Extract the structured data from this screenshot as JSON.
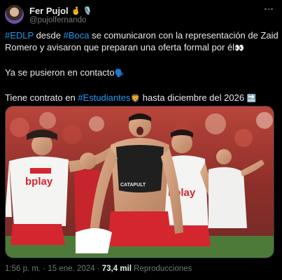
{
  "author": {
    "display_name": "Fer Pujol",
    "name_emojis": "🤞 🎙️",
    "handle": "@pujolfernando"
  },
  "tweet": {
    "line1_tag1": "#EDLP",
    "line1_text1": " desde ",
    "line1_tag2": "#Boca",
    "line1_text2": " se comunicaron con la representación de Zaid",
    "line2": "Romero y avisaron que preparan una oferta formal por él",
    "line2_emoji": "👀",
    "line3": "Ya se pusieron en contacto",
    "line3_emoji": "🗣️",
    "line4_text1": "Tiene contrato en ",
    "line4_tag": "#Estudiantes",
    "line4_emoji": "🦁",
    "line4_text2": " hasta diciembre del 2026 ",
    "line4_emoji2": "🔜"
  },
  "media": {
    "image_icon": "photo-football-celebration",
    "sponsor_left": "bplay",
    "sponsor_right": "bplay",
    "vest_text": "CATAPULT"
  },
  "meta": {
    "time": "1:56 p. m.",
    "sep1": " · ",
    "date": "15 ene. 2024",
    "sep2": " · ",
    "views_count": "73,4 mil",
    "views_label": " Reproducciones"
  }
}
